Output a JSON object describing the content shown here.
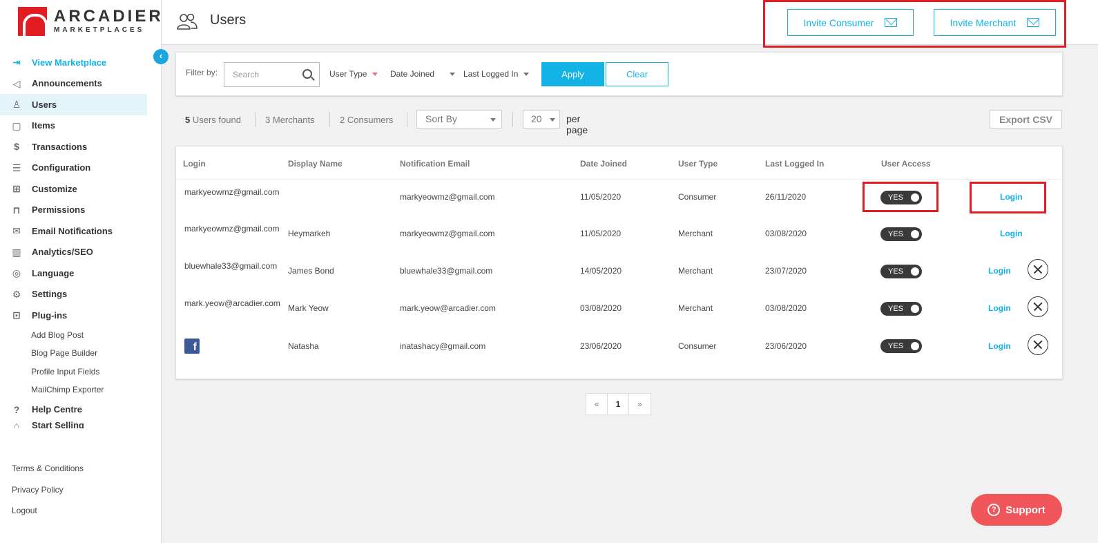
{
  "brand": {
    "name": "ARCADIER",
    "sub": "MARKETPLACES",
    "accent": "#14b3e6",
    "highlight": "#e31b23"
  },
  "sidebar": {
    "items": [
      {
        "label": "View Marketplace",
        "icon": "enter-icon"
      },
      {
        "label": "Announcements",
        "icon": "megaphone-icon"
      },
      {
        "label": "Users",
        "icon": "user-icon"
      },
      {
        "label": "Items",
        "icon": "bag-icon"
      },
      {
        "label": "Transactions",
        "icon": "dollar-icon"
      },
      {
        "label": "Configuration",
        "icon": "sliders-icon"
      },
      {
        "label": "Customize",
        "icon": "grid-icon"
      },
      {
        "label": "Permissions",
        "icon": "lock-icon"
      },
      {
        "label": "Email Notifications",
        "icon": "mail-icon"
      },
      {
        "label": "Analytics/SEO",
        "icon": "chart-icon"
      },
      {
        "label": "Language",
        "icon": "language-icon"
      },
      {
        "label": "Settings",
        "icon": "gear-icon"
      },
      {
        "label": "Plug-ins",
        "icon": "gift-icon"
      }
    ],
    "plugins": [
      "Add Blog Post",
      "Blog Page Builder",
      "Profile Input Fields",
      "MailChimp Exporter"
    ],
    "help": "Help Centre",
    "start_selling": "Start Selling",
    "bottom": [
      "Terms & Conditions",
      "Privacy Policy",
      "Logout"
    ]
  },
  "header": {
    "title": "Users",
    "invite_consumer": "Invite Consumer",
    "invite_merchant": "Invite Merchant"
  },
  "filter": {
    "label": "Filter by:",
    "search_placeholder": "Search",
    "user_type": "User Type",
    "date_joined": "Date Joined",
    "last_logged_in": "Last Logged In",
    "apply": "Apply",
    "clear": "Clear"
  },
  "summary": {
    "users_count": "5",
    "users_label": "Users found",
    "merchants_count": "3",
    "merchants_label": "Merchants",
    "consumers_count": "2",
    "consumers_label": "Consumers",
    "sort_by": "Sort By",
    "per_page_value": "20",
    "per_page_label": "per page",
    "export": "Export CSV"
  },
  "table": {
    "columns": [
      "Login",
      "Display Name",
      "Notification Email",
      "Date Joined",
      "User Type",
      "Last Logged In",
      "User Access"
    ],
    "login_label": "Login",
    "rows": [
      {
        "login": "markyeowmz@gmail.com",
        "display": "",
        "email": "markyeowmz@gmail.com",
        "joined": "11/05/2020",
        "type": "Consumer",
        "last": "26/11/2020",
        "access": "YES"
      },
      {
        "login": "markyeowmz@gmail.com",
        "display": "Heymarkeh",
        "email": "markyeowmz@gmail.com",
        "joined": "11/05/2020",
        "type": "Merchant",
        "last": "03/08/2020",
        "access": "YES"
      },
      {
        "login": "bluewhale33@gmail.com",
        "display": "James Bond",
        "email": "bluewhale33@gmail.com",
        "joined": "14/05/2020",
        "type": "Merchant",
        "last": "23/07/2020",
        "access": "YES"
      },
      {
        "login": "mark.yeow@arcadier.com",
        "display": "Mark Yeow",
        "email": "mark.yeow@arcadier.com",
        "joined": "03/08/2020",
        "type": "Merchant",
        "last": "03/08/2020",
        "access": "YES"
      },
      {
        "login": "",
        "display": "Natasha",
        "email": "inatashacy@gmail.com",
        "joined": "23/06/2020",
        "type": "Consumer",
        "last": "23/06/2020",
        "access": "YES"
      }
    ]
  },
  "pagination": {
    "prev": "«",
    "current": "1",
    "next": "»"
  },
  "support": "Support"
}
